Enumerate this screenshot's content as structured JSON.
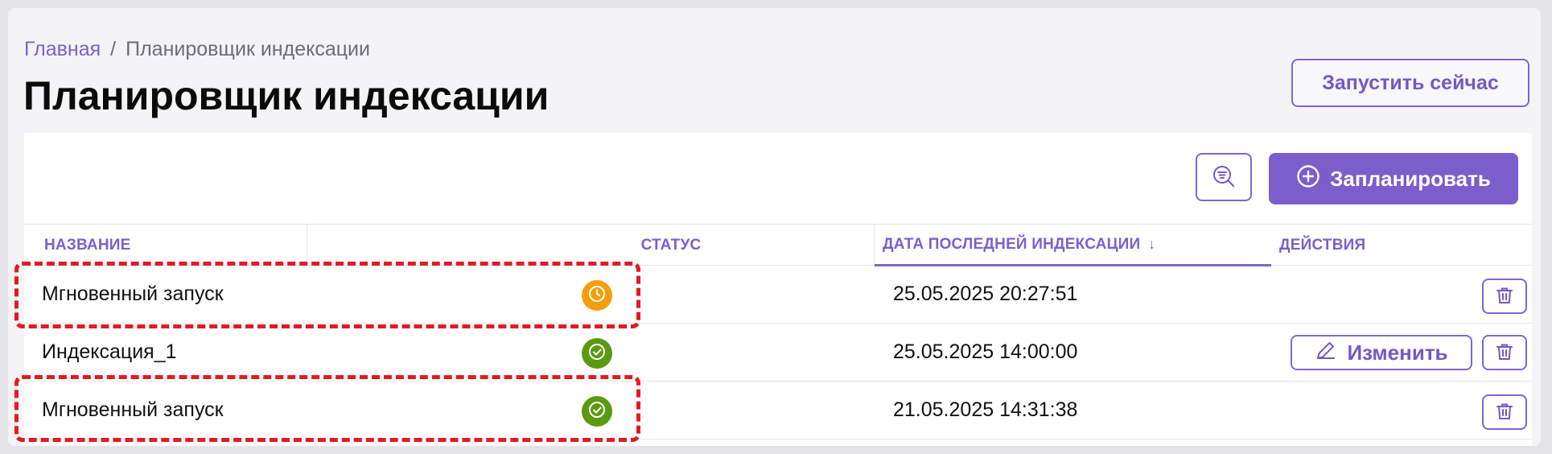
{
  "breadcrumb": {
    "home": "Главная",
    "separator": "/",
    "current": "Планировщик индексации"
  },
  "page": {
    "title": "Планировщик индексации",
    "run_now_label": "Запустить сейчас"
  },
  "toolbar": {
    "filter_icon": "search-filter-icon",
    "schedule_label": "Запланировать",
    "schedule_icon": "plus-circle-icon"
  },
  "table": {
    "columns": {
      "name": "НАЗВАНИЕ",
      "status": "СТАТУС",
      "last_indexed": "ДАТА ПОСЛЕДНЕЙ ИНДЕКСАЦИИ",
      "actions": "ДЕЙСТВИЯ"
    },
    "sort_indicator": "↓",
    "rows": [
      {
        "name": "Мгновенный запуск",
        "status": "pending",
        "status_icon": "clock-icon",
        "date": "25.05.2025 20:27:51",
        "editable": false
      },
      {
        "name": "Индексация_1",
        "status": "success",
        "status_icon": "check-icon",
        "date": "25.05.2025 14:00:00",
        "editable": true,
        "edit_label": "Изменить"
      },
      {
        "name": "Мгновенный запуск",
        "status": "success",
        "status_icon": "check-icon",
        "date": "21.05.2025 14:31:38",
        "editable": false
      }
    ]
  },
  "colors": {
    "accent": "#7b5ecc",
    "pending": "#f59e0b",
    "success": "#5a9a12",
    "highlight": "#e21b22"
  }
}
